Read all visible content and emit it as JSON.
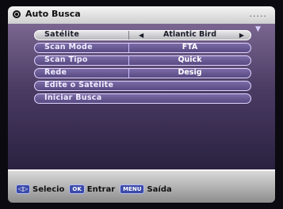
{
  "window": {
    "title": "Auto Busca",
    "title_dots": "....."
  },
  "menu": {
    "rows": [
      {
        "label": "Satélite",
        "value": "Atlantic Bird",
        "selected": true,
        "has_arrows": true
      },
      {
        "label": "Scan Mode",
        "value": "FTA",
        "selected": false
      },
      {
        "label": "Scan Tipo",
        "value": "Quick",
        "selected": false
      },
      {
        "label": "Rede",
        "value": "Desig",
        "selected": false
      },
      {
        "label": "Edite o Satélite",
        "value": "",
        "selected": false
      },
      {
        "label": "Iniciar Busca",
        "value": "",
        "selected": false
      }
    ],
    "scroll_indicator": "▼"
  },
  "footer": {
    "nav_key": "◁▷",
    "select_label": "Selecio",
    "ok_key": "OK",
    "enter_label": "Entrar",
    "menu_key": "MENU",
    "exit_label": "Saída"
  },
  "colors": {
    "panel_top": "#7a6690",
    "panel_bottom": "#2a2140",
    "row": "#6b5a96",
    "row_selected": "#d8d8dc",
    "key_blue": "#3b4aa8"
  }
}
